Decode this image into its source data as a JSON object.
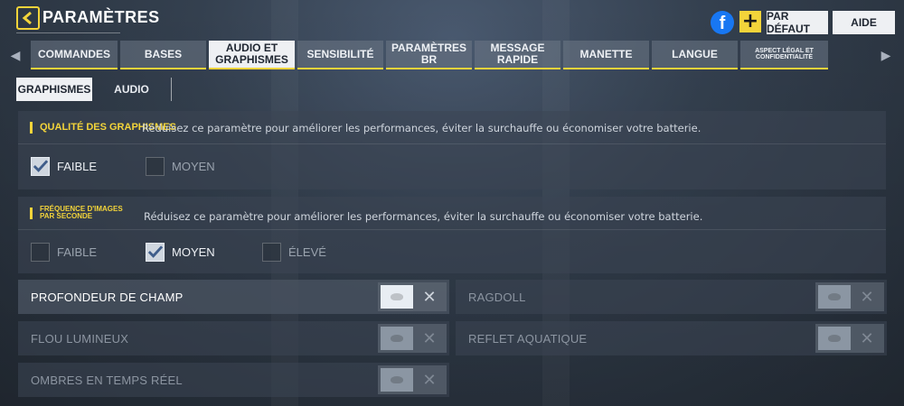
{
  "header": {
    "title": "PARAMÈTRES",
    "facebook_glyph": "f",
    "plus_glyph": "+",
    "default_label": "PAR DÉFAUT",
    "help_label": "AIDE"
  },
  "main_tabs": [
    {
      "label": "COMMANDES",
      "active": false
    },
    {
      "label": "BASES",
      "active": false
    },
    {
      "label": "AUDIO ET GRAPHISMES",
      "active": true
    },
    {
      "label": "SENSIBILITÉ",
      "active": false
    },
    {
      "label": "PARAMÈTRES BR",
      "active": false
    },
    {
      "label": "MESSAGE RAPIDE",
      "active": false
    },
    {
      "label": "MANETTE",
      "active": false
    },
    {
      "label": "LANGUE",
      "active": false
    },
    {
      "label": "ASPECT LÉGAL ET CONFIDENTIALITÉ",
      "active": false
    }
  ],
  "sub_tabs": [
    {
      "label": "GRAPHISMES",
      "active": true
    },
    {
      "label": "AUDIO",
      "active": false
    }
  ],
  "graphics_quality": {
    "label": "QUALITÉ DES GRAPHISMES",
    "description": "Réduisez ce paramètre pour améliorer les performances, éviter la surchauffe ou économiser votre batterie.",
    "options": [
      {
        "label": "FAIBLE",
        "checked": true
      },
      {
        "label": "MOYEN",
        "checked": false
      }
    ]
  },
  "frame_rate": {
    "label": "FRÉQUENCE D'IMAGES PAR SECONDE",
    "description": "Réduisez ce paramètre pour améliorer les performances, éviter la surchauffe ou économiser votre batterie.",
    "options": [
      {
        "label": "FAIBLE",
        "checked": false
      },
      {
        "label": "MOYEN",
        "checked": true
      },
      {
        "label": "ÉLEVÉ",
        "checked": false
      }
    ]
  },
  "toggles": [
    {
      "label": "PROFONDEUR DE CHAMP",
      "enabled": true
    },
    {
      "label": "RAGDOLL",
      "enabled": false
    },
    {
      "label": "FLOU LUMINEUX",
      "enabled": false
    },
    {
      "label": "REFLET AQUATIQUE",
      "enabled": false
    },
    {
      "label": "OMBRES EN TEMPS RÉEL",
      "enabled": false
    }
  ],
  "toggle_off_glyph": "✕",
  "colors": {
    "accent": "#f3d43a",
    "active_tab_bg": "#eef0f3",
    "facebook": "#1877f2"
  }
}
